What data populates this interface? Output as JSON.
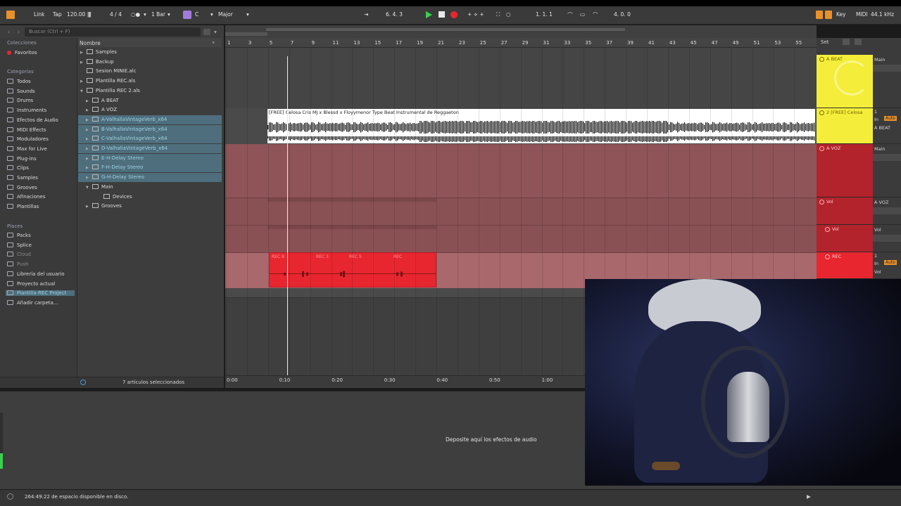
{
  "transport": {
    "link": "Link",
    "tap": "Tap",
    "tempo": "120.00",
    "signature": "4 / 4",
    "quantize": "1 Bar",
    "key": "C",
    "scale": "Major",
    "position": "6.   4.   3",
    "loop_start": "1.   1.   1",
    "loop_length": "4.   0.   0",
    "key_label": "Key",
    "midi_label": "MIDI",
    "sample_rate": "44.1 kHz"
  },
  "browser": {
    "search_placeholder": "Buscar (Ctrl + F)",
    "collections_header": "Colecciones",
    "favorites": "Favoritos",
    "categories_header": "Categorías",
    "categories": [
      "Todos",
      "Sounds",
      "Drums",
      "Instruments",
      "Efectos de Audio",
      "MIDI Effects",
      "Moduladores",
      "Max for Live",
      "Plug-ins",
      "Clips",
      "Samples",
      "Grooves",
      "Afinaciones",
      "Plantillas"
    ],
    "places_header": "Places",
    "places": [
      "Packs",
      "Splice",
      "Cloud",
      "Push",
      "Librería del usuario",
      "Proyecto actual",
      "Plantilla REC Project",
      "Añadir carpeta..."
    ],
    "name_header": "Nombre",
    "files": [
      "Samples",
      "Backup",
      "Sesion MINIE.alc",
      "Plantilla REC.als",
      "Plantilla REC 2.als",
      "A BEAT",
      "A VOZ",
      "A-ValhallaVintageVerb_x64",
      "B-ValhallaVintageVerb_x64",
      "C-ValhallaVintageVerb_x64",
      "D-ValhallaVintageVerb_x64",
      "E-H-Delay Stereo",
      "F-H-Delay Stereo",
      "G-H-Delay Stereo",
      "Main",
      "Devices",
      "Grooves"
    ],
    "footer": "7 artículos seleccionados"
  },
  "arrangement": {
    "bars": [
      "1",
      "3",
      "5",
      "7",
      "9",
      "11",
      "13",
      "15",
      "17",
      "19",
      "21",
      "23",
      "25",
      "27",
      "29",
      "31",
      "33",
      "35",
      "37",
      "39",
      "41",
      "43",
      "45",
      "47",
      "49",
      "51",
      "53",
      "55"
    ],
    "time_marks": [
      "0:00",
      "0:10",
      "0:20",
      "0:30",
      "0:40",
      "0:50",
      "1:00"
    ],
    "audio_clip_title": "[FREE] Celosa Cris MJ x Blessd x Floyymenor Type Beat  Instrumental de Reggaeton",
    "rec_clip_labels": [
      "REC 8",
      "REC 3",
      "REC 5",
      "REC"
    ],
    "set_label": "Set"
  },
  "mixer": {
    "tracks": [
      {
        "name": "A BEAT",
        "out": "Main",
        "color": "#f4ee3a"
      },
      {
        "name": "2 [FREE] Celosa",
        "out": "A BEAT",
        "color": "#f4ee3a",
        "num": "1",
        "in": "In",
        "auto": "Auto"
      },
      {
        "name": "A VOZ",
        "out": "Main",
        "color": "#b3232c"
      },
      {
        "name": "Vol",
        "out": "A VOZ",
        "color": "#b3232c"
      },
      {
        "name": "Vol",
        "out": "Vol",
        "color": "#b3232c"
      },
      {
        "name": "REC",
        "out": "Vol",
        "color": "#e8262f",
        "num": "1",
        "in": "In",
        "auto": "Auto"
      }
    ]
  },
  "detail": {
    "drop_hint": "Deposite aquí los efectos de audio"
  },
  "status": {
    "disk": "264:49:22 de espacio disponible en disco."
  },
  "colors": {
    "accent_orange": "#e8902a",
    "record_red": "#e8262f",
    "beat_yellow": "#f4ee3a",
    "voz_red": "#b3232c",
    "selection_teal": "#4e6e7d"
  }
}
